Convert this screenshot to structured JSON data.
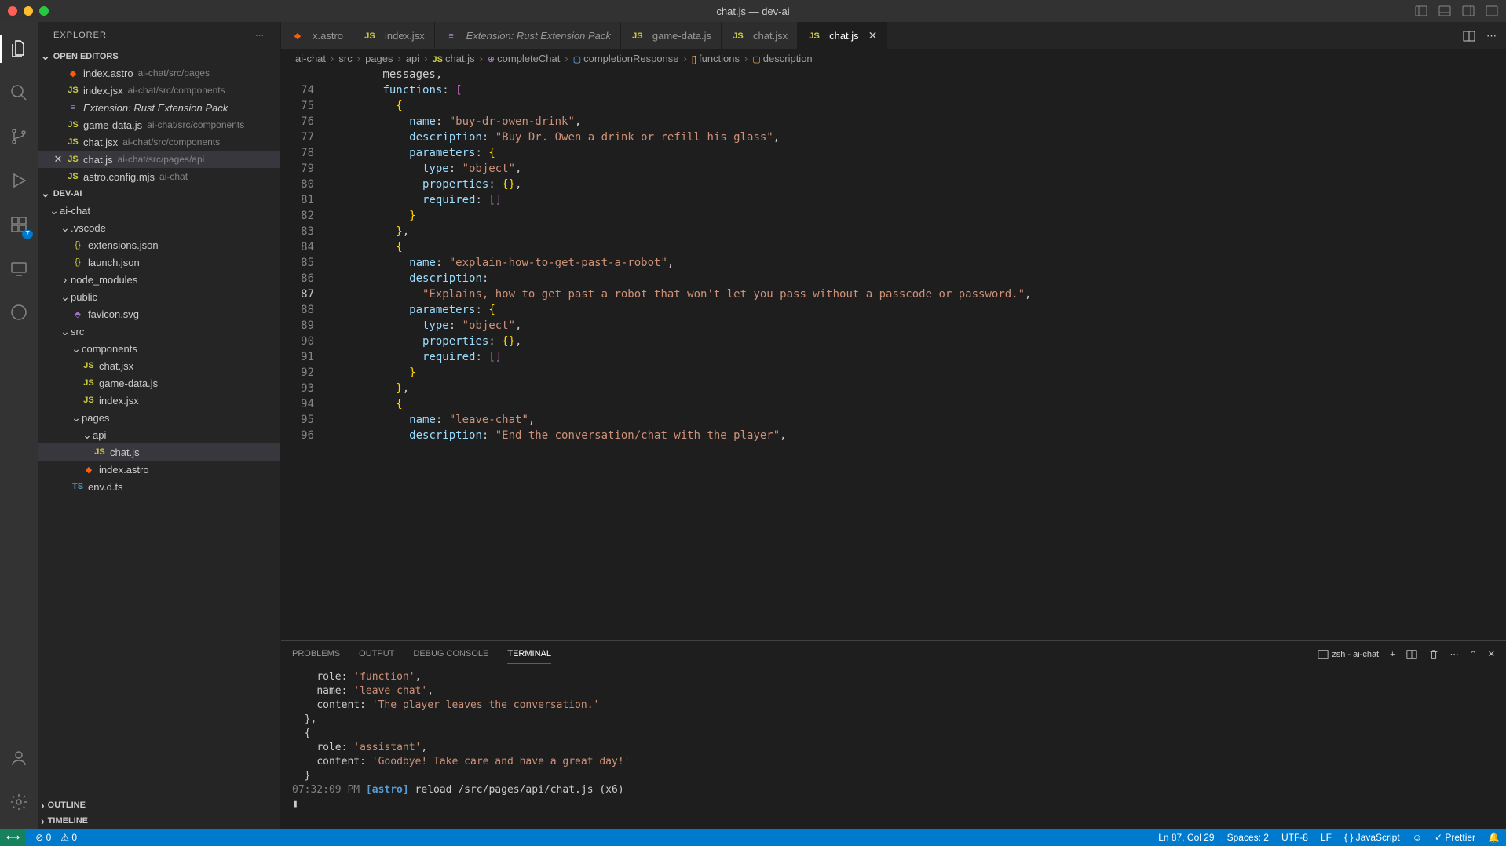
{
  "window": {
    "title": "chat.js — dev-ai"
  },
  "sidebar": {
    "title": "EXPLORER",
    "openEditors": {
      "label": "OPEN EDITORS",
      "items": [
        {
          "name": "index.astro",
          "path": "ai-chat/src/pages",
          "icon": "astro"
        },
        {
          "name": "index.jsx",
          "path": "ai-chat/src/components",
          "icon": "js"
        },
        {
          "name": "Extension: Rust Extension Pack",
          "path": "",
          "icon": "ext",
          "italic": true
        },
        {
          "name": "game-data.js",
          "path": "ai-chat/src/components",
          "icon": "js"
        },
        {
          "name": "chat.jsx",
          "path": "ai-chat/src/components",
          "icon": "js"
        },
        {
          "name": "chat.js",
          "path": "ai-chat/src/pages/api",
          "icon": "js",
          "active": true
        },
        {
          "name": "astro.config.mjs",
          "path": "ai-chat",
          "icon": "js"
        }
      ]
    },
    "project": {
      "label": "DEV-AI",
      "tree": [
        {
          "name": "ai-chat",
          "type": "folder",
          "depth": 1
        },
        {
          "name": ".vscode",
          "type": "folder",
          "depth": 2
        },
        {
          "name": "extensions.json",
          "type": "file",
          "icon": "json",
          "depth": 3
        },
        {
          "name": "launch.json",
          "type": "file",
          "icon": "json",
          "depth": 3
        },
        {
          "name": "node_modules",
          "type": "folder",
          "depth": 2,
          "collapsed": true
        },
        {
          "name": "public",
          "type": "folder",
          "depth": 2
        },
        {
          "name": "favicon.svg",
          "type": "file",
          "icon": "svg",
          "depth": 3
        },
        {
          "name": "src",
          "type": "folder",
          "depth": 2
        },
        {
          "name": "components",
          "type": "folder",
          "depth": 3
        },
        {
          "name": "chat.jsx",
          "type": "file",
          "icon": "js",
          "depth": 4
        },
        {
          "name": "game-data.js",
          "type": "file",
          "icon": "js",
          "depth": 4
        },
        {
          "name": "index.jsx",
          "type": "file",
          "icon": "js",
          "depth": 4
        },
        {
          "name": "pages",
          "type": "folder",
          "depth": 3
        },
        {
          "name": "api",
          "type": "folder",
          "depth": 4
        },
        {
          "name": "chat.js",
          "type": "file",
          "icon": "js",
          "depth": 5,
          "selected": true
        },
        {
          "name": "index.astro",
          "type": "file",
          "icon": "astro",
          "depth": 4
        },
        {
          "name": "env.d.ts",
          "type": "file",
          "icon": "ts",
          "depth": 3
        }
      ]
    },
    "outline": "OUTLINE",
    "timeline": "TIMELINE"
  },
  "activity": {
    "badge": "7"
  },
  "tabs": [
    {
      "label": "x.astro",
      "icon": "astro"
    },
    {
      "label": "index.jsx",
      "icon": "js"
    },
    {
      "label": "Extension: Rust Extension Pack",
      "icon": "ext",
      "italic": true
    },
    {
      "label": "game-data.js",
      "icon": "js"
    },
    {
      "label": "chat.jsx",
      "icon": "js"
    },
    {
      "label": "chat.js",
      "icon": "js",
      "active": true
    }
  ],
  "breadcrumbs": [
    "ai-chat",
    "src",
    "pages",
    "api",
    "chat.js",
    "completeChat",
    "completionResponse",
    "functions",
    "description"
  ],
  "code": {
    "startLine": 74,
    "activeLine": 87,
    "lines": [
      "        messages,",
      "        functions: [",
      "          {",
      "            name: \"buy-dr-owen-drink\",",
      "            description: \"Buy Dr. Owen a drink or refill his glass\",",
      "            parameters: {",
      "              type: \"object\",",
      "              properties: {},",
      "              required: []",
      "            }",
      "          },",
      "          {",
      "            name: \"explain-how-to-get-past-a-robot\",",
      "            description:",
      "              \"Explains, how to get past a robot that won't let you pass without a passcode or password.\",",
      "            parameters: {",
      "              type: \"object\",",
      "              properties: {},",
      "              required: []",
      "            }",
      "          },",
      "          {",
      "            name: \"leave-chat\",",
      "            description: \"End the conversation/chat with the player\","
    ]
  },
  "panel": {
    "tabs": [
      "PROBLEMS",
      "OUTPUT",
      "DEBUG CONSOLE",
      "TERMINAL"
    ],
    "activeTab": 3,
    "shell": "zsh - ai-chat",
    "terminal": [
      "    role: 'function',",
      "    name: 'leave-chat',",
      "    content: 'The player leaves the conversation.'",
      "  },",
      "  {",
      "    role: 'assistant',",
      "    content: 'Goodbye! Take care and have a great day!'",
      "  }",
      "07:32:09 PM [astro] reload /src/pages/api/chat.js (x6)",
      "▮"
    ]
  },
  "statusbar": {
    "errors": "0",
    "warnings": "0",
    "cursor": "Ln 87, Col 29",
    "spaces": "Spaces: 2",
    "encoding": "UTF-8",
    "eol": "LF",
    "lang": "JavaScript",
    "prettier": "Prettier"
  }
}
